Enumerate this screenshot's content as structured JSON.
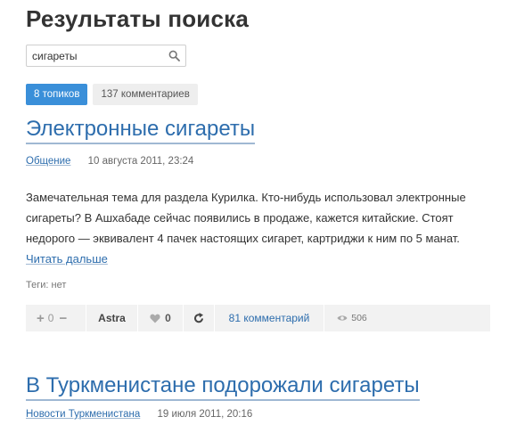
{
  "page": {
    "title": "Результаты поиска"
  },
  "search": {
    "value": "сигареты",
    "placeholder": ""
  },
  "tabs": [
    {
      "label": "8 топиков",
      "active": true
    },
    {
      "label": "137 комментариев",
      "active": false
    }
  ],
  "posts": [
    {
      "title": "Электронные сигареты",
      "category": "Общение",
      "date": "10 августа 2011, 23:24",
      "body": "Замечательная тема для раздела Курилка. Кто-нибудь использовал электронные сигареты? В Ашхабаде сейчас появились в продаже, кажется китайские. Стоят недорого — эквивалент 4 пачек настоящих сигарет, картриджи к ним по 5 манат.",
      "read_more": "Читать дальше",
      "tags": "Теги: нет",
      "actions": {
        "vote_plus": "+",
        "vote_count": "0",
        "vote_minus": "−",
        "author": "Astra",
        "favorites": "0",
        "comments": "81 комментарий",
        "views": "506"
      }
    },
    {
      "title": "В Туркменистане подорожали сигареты",
      "category": "Новости Туркменистана",
      "date": "19 июля 2011, 20:16"
    }
  ],
  "colors": {
    "accent": "#3a8fd9",
    "link": "#2d6dad",
    "bar": "#f2f2f2"
  }
}
